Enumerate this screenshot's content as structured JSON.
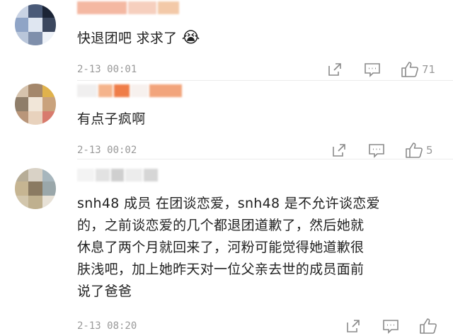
{
  "comments": [
    {
      "text": "快退团吧 求求了",
      "emoji": "😭",
      "time": "2-13 00:01",
      "likes": "71",
      "username_blurred": true
    },
    {
      "text": "有点子疯啊",
      "time": "2-13 00:02",
      "likes": "5",
      "username_blurred": true
    },
    {
      "lines": [
        "snh48 成员 在团谈恋爱，snh48 是不允许谈恋爱",
        "的，之前谈恋爱的几个都退团道歉了，然后她就",
        "休息了两个月就回来了，河粉可能觉得她道歉很",
        "肤浅吧，加上她昨天对一位父亲去世的成员面前",
        "说了爸爸"
      ],
      "time": "2-13 08:20",
      "likes": "",
      "username_blurred": true
    }
  ],
  "icons": [
    "share-icon",
    "comment-icon",
    "like-icon"
  ],
  "colors": {
    "text": "#222222",
    "meta": "#999999",
    "icon": "#8a8a8a"
  }
}
